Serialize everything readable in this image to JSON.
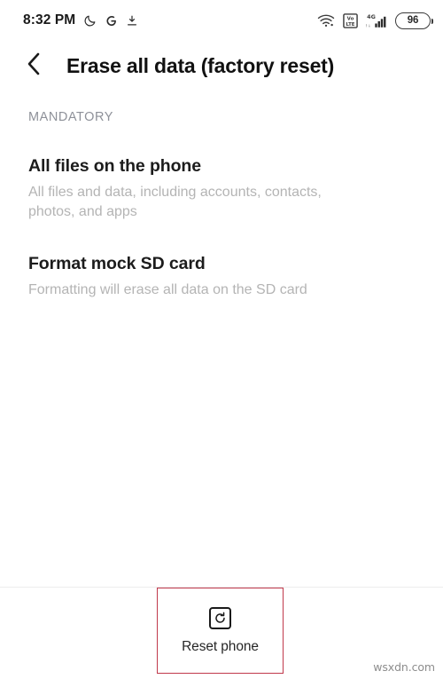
{
  "status_bar": {
    "clock": "8:32 PM",
    "left_icons": [
      {
        "name": "do-not-disturb-moon-icon",
        "glyph": "moon"
      },
      {
        "name": "google-g-icon",
        "glyph": "G"
      },
      {
        "name": "download-icon",
        "glyph": "download"
      }
    ],
    "right_icons": [
      {
        "name": "wifi-icon",
        "glyph": "wifi"
      },
      {
        "name": "volte-icon",
        "glyph": "VoLTE"
      },
      {
        "name": "mobile-signal-icon",
        "glyph": "4G",
        "network_label": "4G"
      }
    ],
    "battery_level": "96"
  },
  "app_bar": {
    "back_label": "Back",
    "title": "Erase all data (factory reset)"
  },
  "content": {
    "section_label": "MANDATORY",
    "items": [
      {
        "title": "All files on the phone",
        "description": "All files and data, including accounts, contacts, photos, and apps"
      },
      {
        "title": "Format mock SD card",
        "description": "Formatting will erase all data on the SD card"
      }
    ]
  },
  "bottom_bar": {
    "reset_label": "Reset phone",
    "reset_icon": "reset-phone-icon"
  },
  "watermark": "wsxdn.com",
  "colors": {
    "highlight_box": "#c0394b",
    "title_text": "#111111",
    "muted_text": "#b4b4b4",
    "section_label": "#8e9199",
    "background": "#ffffff",
    "divider": "#ededed"
  }
}
